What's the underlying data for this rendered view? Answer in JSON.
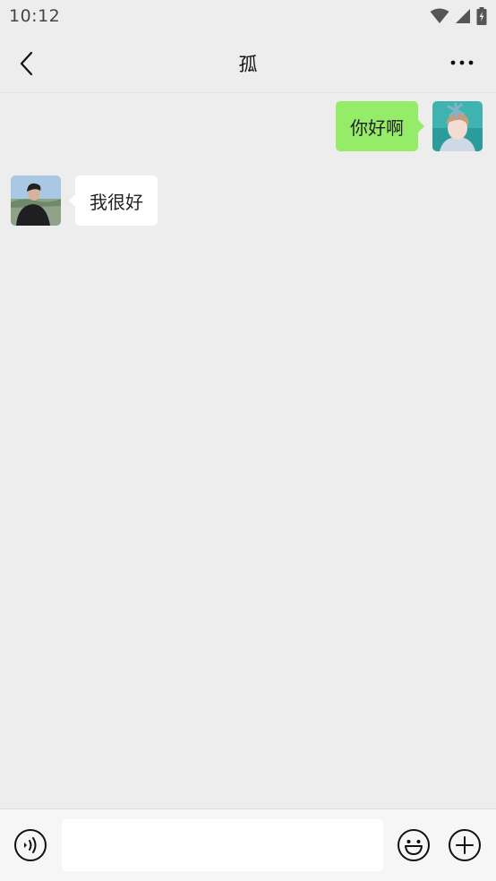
{
  "status_bar": {
    "time": "10:12"
  },
  "header": {
    "title": "孤",
    "back_icon": "chevron-left-icon",
    "more_icon": "more-horizontal-icon"
  },
  "messages": [
    {
      "direction": "outgoing",
      "text": "你好啊",
      "avatar": "girl-avatar"
    },
    {
      "direction": "incoming",
      "text": "我很好",
      "avatar": "boy-avatar"
    }
  ],
  "input_bar": {
    "value": "",
    "placeholder": "",
    "voice_icon": "voice-icon",
    "emoji_icon": "emoji-icon",
    "add_icon": "plus-circle-icon"
  },
  "colors": {
    "background": "#ededed",
    "outgoing_bubble": "#95ec69",
    "incoming_bubble": "#ffffff",
    "input_bar": "#f6f6f6"
  }
}
